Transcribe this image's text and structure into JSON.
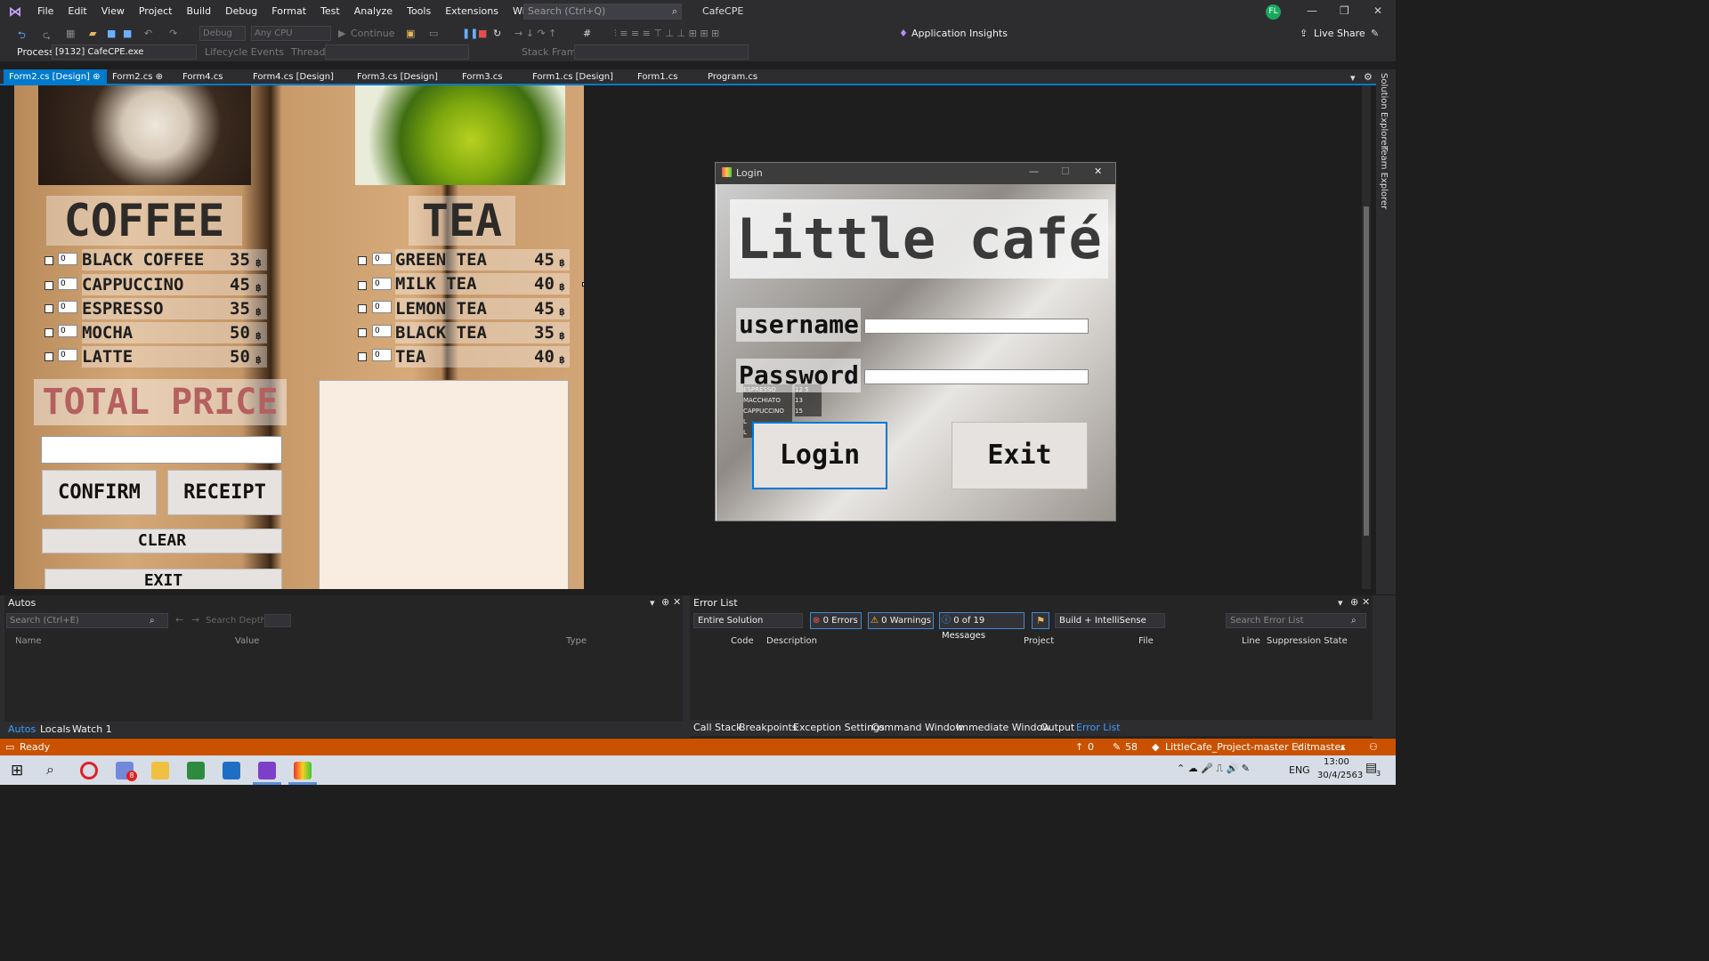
{
  "titlebar": {
    "menus": [
      "File",
      "Edit",
      "View",
      "Project",
      "Build",
      "Debug",
      "Format",
      "Test",
      "Analyze",
      "Tools",
      "Extensions",
      "Window",
      "Help"
    ],
    "search_placeholder": "Search (Ctrl+Q)",
    "app_title": "CafeCPE",
    "avatar_initials": "FL"
  },
  "toolbar": {
    "config": "Debug",
    "platform": "Any CPU",
    "continue_label": "Continue",
    "app_insights": "Application Insights",
    "live_share": "Live Share"
  },
  "procbar": {
    "process_label": "Process:",
    "process_value": "[9132] CafeCPE.exe",
    "lifecycle": "Lifecycle Events",
    "thread_label": "Thread:",
    "stack_label": "Stack Frame:"
  },
  "tabs": [
    "Form2.cs [Design]",
    "Form2.cs",
    "Form4.cs",
    "Form4.cs [Design]",
    "Form3.cs [Design]",
    "Form3.cs",
    "Form1.cs [Design]",
    "Form1.cs",
    "Program.cs"
  ],
  "side_tabs": [
    "Solution Explorer",
    "Team Explorer"
  ],
  "form2": {
    "coffee_title": "COFFEE",
    "tea_title": "TEA",
    "coffee_items": [
      {
        "name": "BLACK COFFEE",
        "qty": "0",
        "price": "35",
        "cur": "฿"
      },
      {
        "name": "CAPPUCCINO",
        "qty": "0",
        "price": "45",
        "cur": "฿"
      },
      {
        "name": "ESPRESSO",
        "qty": "0",
        "price": "35",
        "cur": "฿"
      },
      {
        "name": "MOCHA",
        "qty": "0",
        "price": "50",
        "cur": "฿"
      },
      {
        "name": "LATTE",
        "qty": "0",
        "price": "50",
        "cur": "฿"
      }
    ],
    "tea_items": [
      {
        "name": "GREEN TEA",
        "qty": "0",
        "price": "45",
        "cur": "฿"
      },
      {
        "name": "MILK TEA",
        "qty": "0",
        "price": "40",
        "cur": "฿"
      },
      {
        "name": "LEMON TEA",
        "qty": "0",
        "price": "45",
        "cur": "฿"
      },
      {
        "name": "BLACK TEA",
        "qty": "0",
        "price": "35",
        "cur": "฿"
      },
      {
        "name": "TEA",
        "qty": "0",
        "price": "40",
        "cur": "฿"
      }
    ],
    "total_label": "TOTAL PRICE",
    "confirm": "CONFIRM",
    "receipt": "RECEIPT",
    "clear": "CLEAR",
    "exit": "EXIT"
  },
  "login": {
    "title": "Login",
    "heading": "Little café",
    "username_label": "username",
    "password_label": "Password",
    "login_button": "Login",
    "exit_button": "Exit",
    "chalk_lines": [
      "ESPRESSO",
      "MACCHIATO",
      "CAPPUCCINO",
      "L",
      "L"
    ],
    "chalk_prices": [
      "12 5",
      "13",
      "15"
    ]
  },
  "autos": {
    "title": "Autos",
    "search_placeholder": "Search (Ctrl+E)",
    "search_depth": "Search Depth:",
    "cols": [
      "Name",
      "Value",
      "Type"
    ],
    "bottom_tabs": [
      "Autos",
      "Locals",
      "Watch 1"
    ]
  },
  "errorlist": {
    "title": "Error List",
    "scope": "Entire Solution",
    "errors": "0 Errors",
    "warnings": "0 Warnings",
    "messages": "0 of 19 Messages",
    "build_filter": "Build + IntelliSense",
    "search_placeholder": "Search Error List",
    "cols": [
      "Code",
      "Description",
      "Project",
      "File",
      "Line",
      "Suppression State"
    ],
    "bottom_tabs": [
      "Call Stack",
      "Breakpoints",
      "Exception Settings",
      "Command Window",
      "Immediate Window",
      "Output",
      "Error List"
    ]
  },
  "status": {
    "ready": "Ready",
    "up_count": "0",
    "edit_count": "58",
    "repo": "LittleCafe_Project-master Edit",
    "branch": "master"
  },
  "taskbar": {
    "lang": "ENG",
    "time": "13:00",
    "date": "30/4/2563",
    "notif_count": "3",
    "chat_badge": "8"
  },
  "colors": {
    "accent": "#007acc",
    "status": "#ca5100",
    "total": "#b56060"
  }
}
